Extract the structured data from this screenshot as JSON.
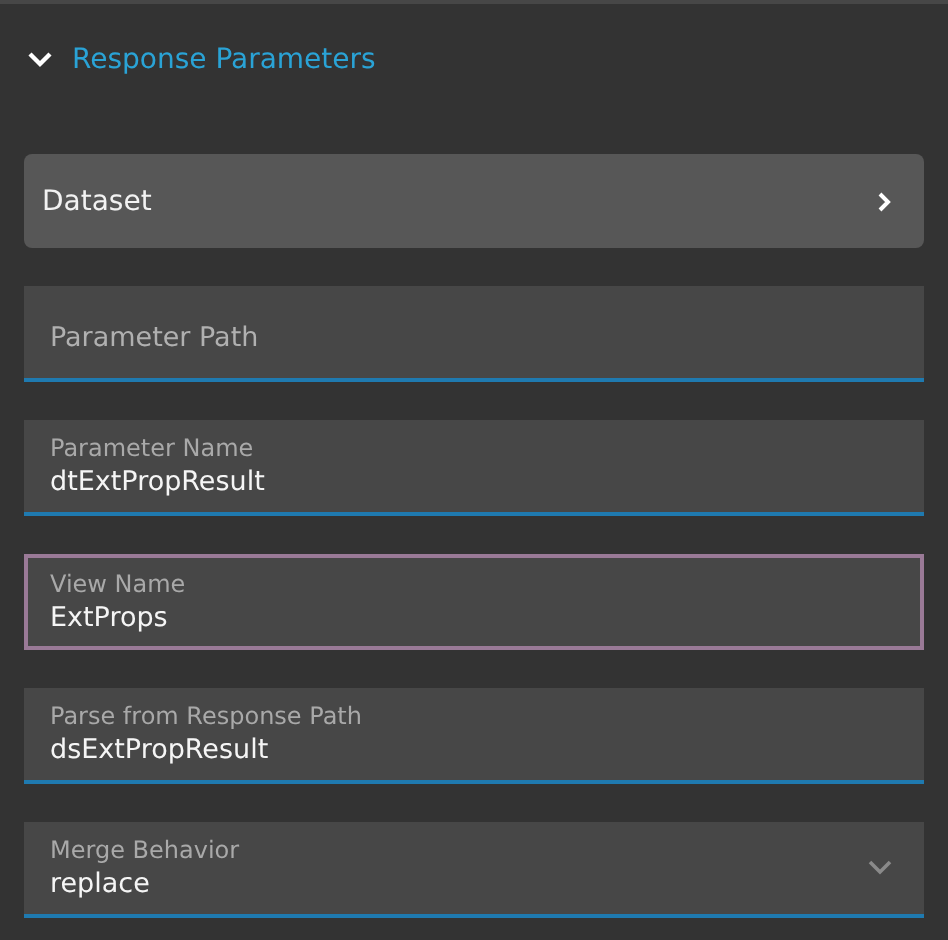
{
  "section": {
    "title": "Response Parameters",
    "expanded": true
  },
  "dataset_button": {
    "label": "Dataset"
  },
  "fields": [
    {
      "kind": "text",
      "placeholder": "Parameter Path",
      "focused": false
    },
    {
      "kind": "text",
      "label": "Parameter Name",
      "value": "dtExtPropResult",
      "focused": false
    },
    {
      "kind": "text",
      "label": "View Name",
      "value": "ExtProps",
      "focused": true
    },
    {
      "kind": "text",
      "label": "Parse from Response Path",
      "value": "dsExtPropResult",
      "focused": false
    },
    {
      "kind": "select",
      "label": "Merge Behavior",
      "value": "replace",
      "focused": false
    }
  ]
}
